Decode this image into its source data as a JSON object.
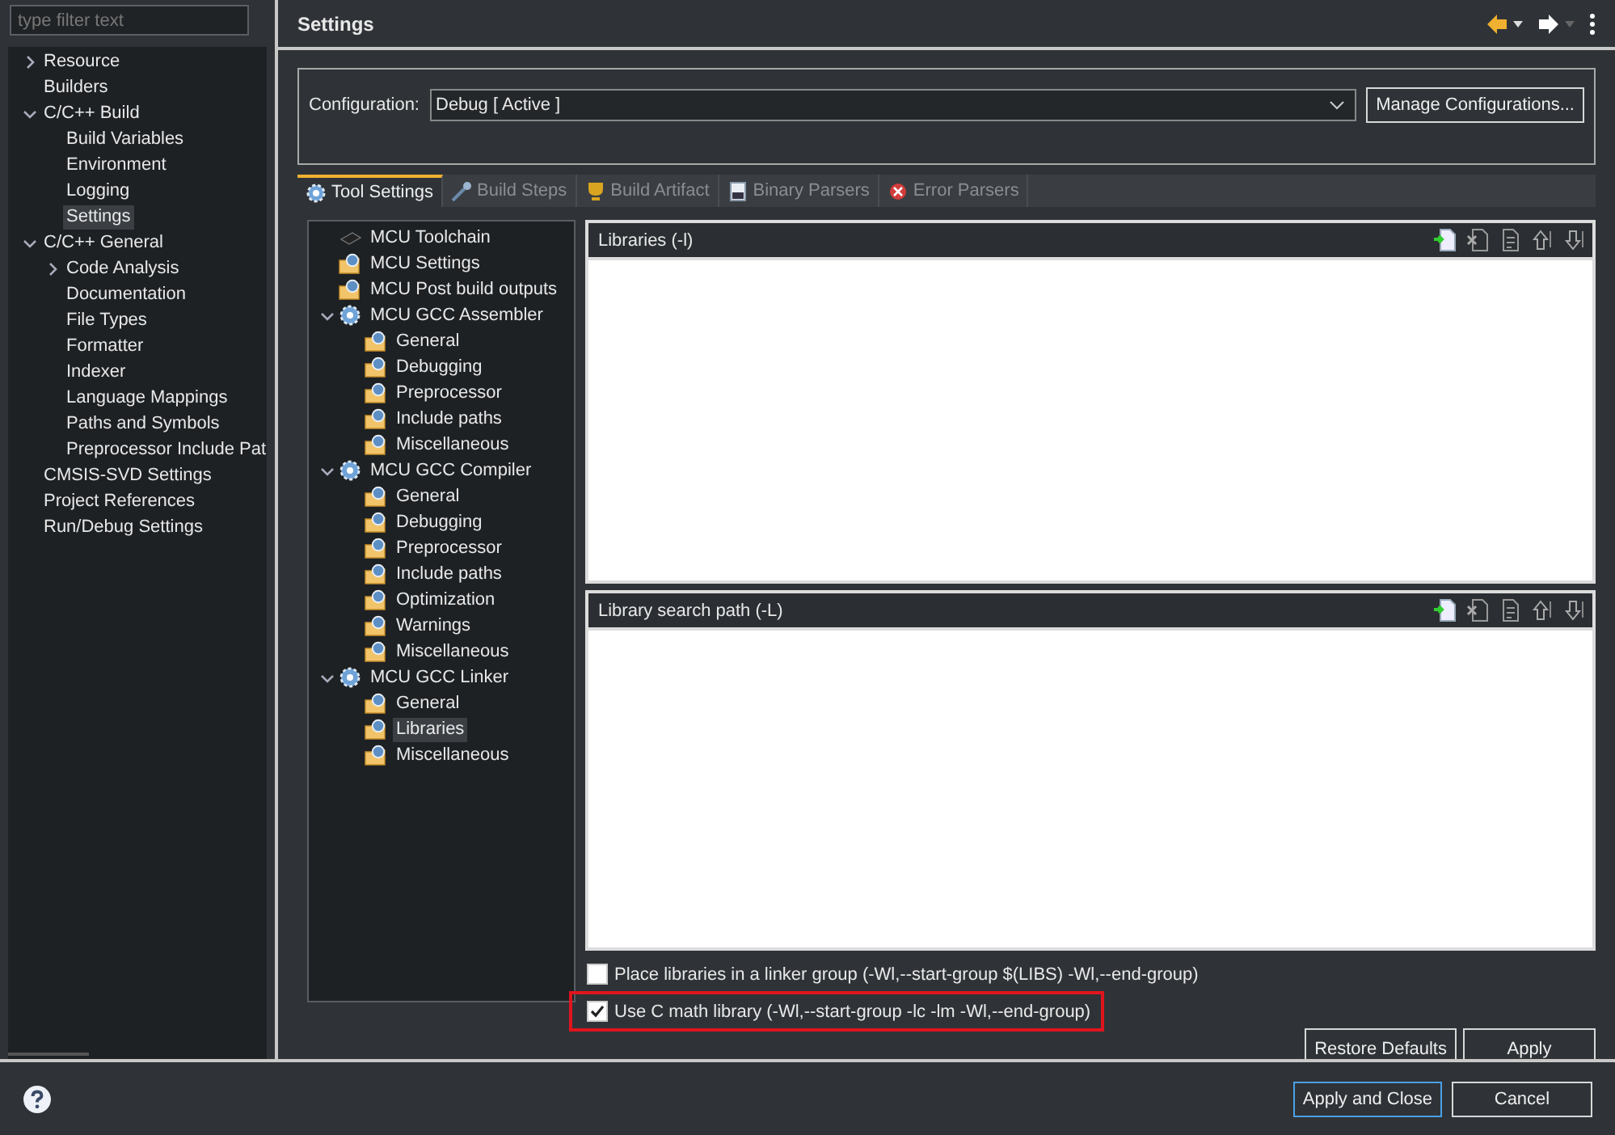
{
  "filter": {
    "placeholder": "type filter text"
  },
  "nav": [
    {
      "label": "Resource",
      "expanded": false,
      "selected": false
    },
    {
      "label": "Builders",
      "selected": false
    },
    {
      "label": "C/C++ Build",
      "expanded": true,
      "selected": false,
      "children": [
        {
          "label": "Build Variables",
          "selected": false
        },
        {
          "label": "Environment",
          "selected": false
        },
        {
          "label": "Logging",
          "selected": false
        },
        {
          "label": "Settings",
          "selected": true
        }
      ]
    },
    {
      "label": "C/C++ General",
      "expanded": true,
      "selected": false,
      "children": [
        {
          "label": "Code Analysis",
          "expanded": false,
          "selected": false
        },
        {
          "label": "Documentation",
          "selected": false
        },
        {
          "label": "File Types",
          "selected": false
        },
        {
          "label": "Formatter",
          "selected": false
        },
        {
          "label": "Indexer",
          "selected": false
        },
        {
          "label": "Language Mappings",
          "selected": false
        },
        {
          "label": "Paths and Symbols",
          "selected": false
        },
        {
          "label": "Preprocessor Include Pat",
          "selected": false
        }
      ]
    },
    {
      "label": "CMSIS-SVD Settings",
      "selected": false
    },
    {
      "label": "Project References",
      "selected": false
    },
    {
      "label": "Run/Debug Settings",
      "selected": false
    }
  ],
  "title": "Settings",
  "configuration": {
    "label": "Configuration:",
    "value": "Debug  [ Active ]",
    "button": "Manage Configurations..."
  },
  "tabs": [
    {
      "label": "Tool Settings",
      "selected": true
    },
    {
      "label": "Build Steps",
      "selected": false
    },
    {
      "label": "Build Artifact",
      "selected": false
    },
    {
      "label": "Binary Parsers",
      "selected": false
    },
    {
      "label": "Error Parsers",
      "selected": false
    }
  ],
  "tool_tree": [
    {
      "label": "MCU Toolchain",
      "kind": "chip",
      "selected": false
    },
    {
      "label": "MCU Settings",
      "kind": "folder",
      "selected": false
    },
    {
      "label": "MCU Post build outputs",
      "kind": "folder",
      "selected": false
    },
    {
      "label": "MCU GCC Assembler",
      "kind": "gear",
      "expanded": true,
      "selected": false,
      "children": [
        {
          "label": "General",
          "kind": "folder",
          "selected": false
        },
        {
          "label": "Debugging",
          "kind": "folder",
          "selected": false
        },
        {
          "label": "Preprocessor",
          "kind": "folder",
          "selected": false
        },
        {
          "label": "Include paths",
          "kind": "folder",
          "selected": false
        },
        {
          "label": "Miscellaneous",
          "kind": "folder",
          "selected": false
        }
      ]
    },
    {
      "label": "MCU GCC Compiler",
      "kind": "gear",
      "expanded": true,
      "selected": false,
      "children": [
        {
          "label": "General",
          "kind": "folder",
          "selected": false
        },
        {
          "label": "Debugging",
          "kind": "folder",
          "selected": false
        },
        {
          "label": "Preprocessor",
          "kind": "folder",
          "selected": false
        },
        {
          "label": "Include paths",
          "kind": "folder",
          "selected": false
        },
        {
          "label": "Optimization",
          "kind": "folder",
          "selected": false
        },
        {
          "label": "Warnings",
          "kind": "folder",
          "selected": false
        },
        {
          "label": "Miscellaneous",
          "kind": "folder",
          "selected": false
        }
      ]
    },
    {
      "label": "MCU GCC Linker",
      "kind": "gear",
      "expanded": true,
      "selected": false,
      "children": [
        {
          "label": "General",
          "kind": "folder",
          "selected": false
        },
        {
          "label": "Libraries",
          "kind": "folder",
          "selected": true
        },
        {
          "label": "Miscellaneous",
          "kind": "folder",
          "selected": false
        }
      ]
    }
  ],
  "lists": [
    {
      "title": "Libraries (-l)"
    },
    {
      "title": "Library search path (-L)"
    }
  ],
  "options": [
    {
      "label": "Place libraries in a linker group (-Wl,--start-group $(LIBS) -Wl,--end-group)",
      "checked": false,
      "highlighted": false
    },
    {
      "label": "Use C math library (-Wl,--start-group -lc -lm -Wl,--end-group)",
      "checked": true,
      "highlighted": true
    }
  ],
  "page_buttons": [
    "Restore Defaults",
    "Apply"
  ],
  "footer_buttons": [
    {
      "label": "Apply and Close",
      "default": true
    },
    {
      "label": "Cancel",
      "default": false
    }
  ]
}
